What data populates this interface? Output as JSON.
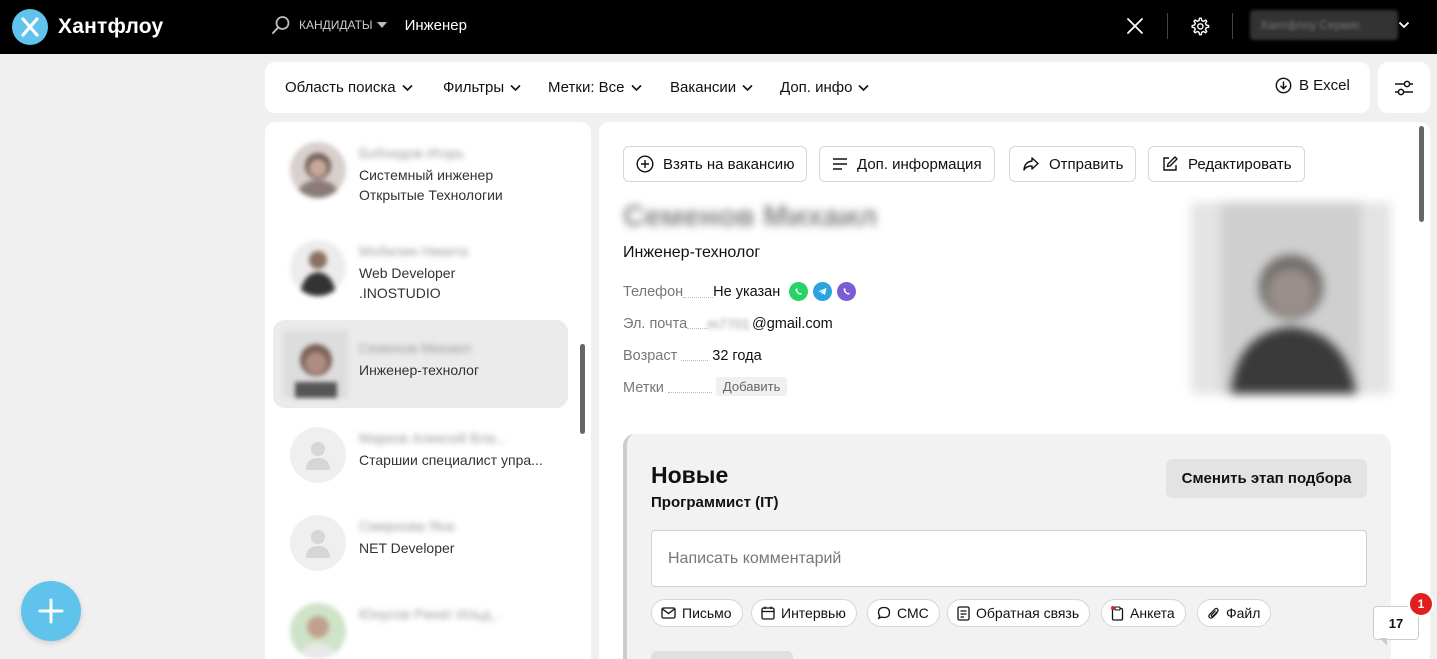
{
  "app": {
    "name": "Хантфлоу"
  },
  "search": {
    "scope": "КАНДИДАТЫ",
    "query": "Инженер"
  },
  "user": {
    "name": "Хантфлоу Сервис"
  },
  "filters": [
    {
      "label": "Область поиска"
    },
    {
      "label": "Фильтры"
    },
    {
      "label": "Метки: Все"
    },
    {
      "label": "Вакансии"
    },
    {
      "label": "Доп. инфо"
    }
  ],
  "export": {
    "label": "В Excel"
  },
  "candidates": [
    {
      "name": "Бобоедов Игорь",
      "title": "Системный инженер",
      "company": "Открытые Технологии"
    },
    {
      "name": "Мобилин Никита",
      "title": "Web Developer",
      "company": ".INOSTUDIO"
    },
    {
      "name": "Семенов Михаил",
      "title": "Инженер-технолог",
      "company": ""
    },
    {
      "name": "Марков Алексей Вла...",
      "title": "Старшии специалист упра...",
      "company": ""
    },
    {
      "name": "Смирнова Яна",
      "title": "NET Developer",
      "company": ""
    },
    {
      "name": "Юнусов Ринат Ильд...",
      "title": "",
      "company": ""
    }
  ],
  "actions": {
    "take": "Взять на вакансию",
    "info": "Доп. информация",
    "send": "Отправить",
    "edit": "Редактировать"
  },
  "profile": {
    "name": "Семенов Михаил",
    "position": "Инженер-технолог",
    "phone_label": "Телефон",
    "phone_value": "Не указан",
    "email_label": "Эл. почта",
    "email_local": "m7701",
    "email_domain": "@gmail.com",
    "age_label": "Возраст",
    "age_value": "32 года",
    "tags_label": "Метки",
    "tags_add": "Добавить"
  },
  "stage": {
    "title": "Новые",
    "vacancy": "Программист (IT)",
    "change_label": "Сменить этап подбора",
    "comment_placeholder": "Написать комментарий",
    "chips": [
      "Письмо",
      "Интервью",
      "СМС",
      "Обратная связь",
      "Анкета",
      "Файл"
    ]
  },
  "chat": {
    "count": "17",
    "badge": "1"
  },
  "colors": {
    "accent": "#5fc3ec",
    "topbar": "#000000",
    "whatsapp": "#25d366",
    "telegram": "#2aa3df",
    "viber": "#7b5cd6",
    "badge": "#e02020"
  }
}
